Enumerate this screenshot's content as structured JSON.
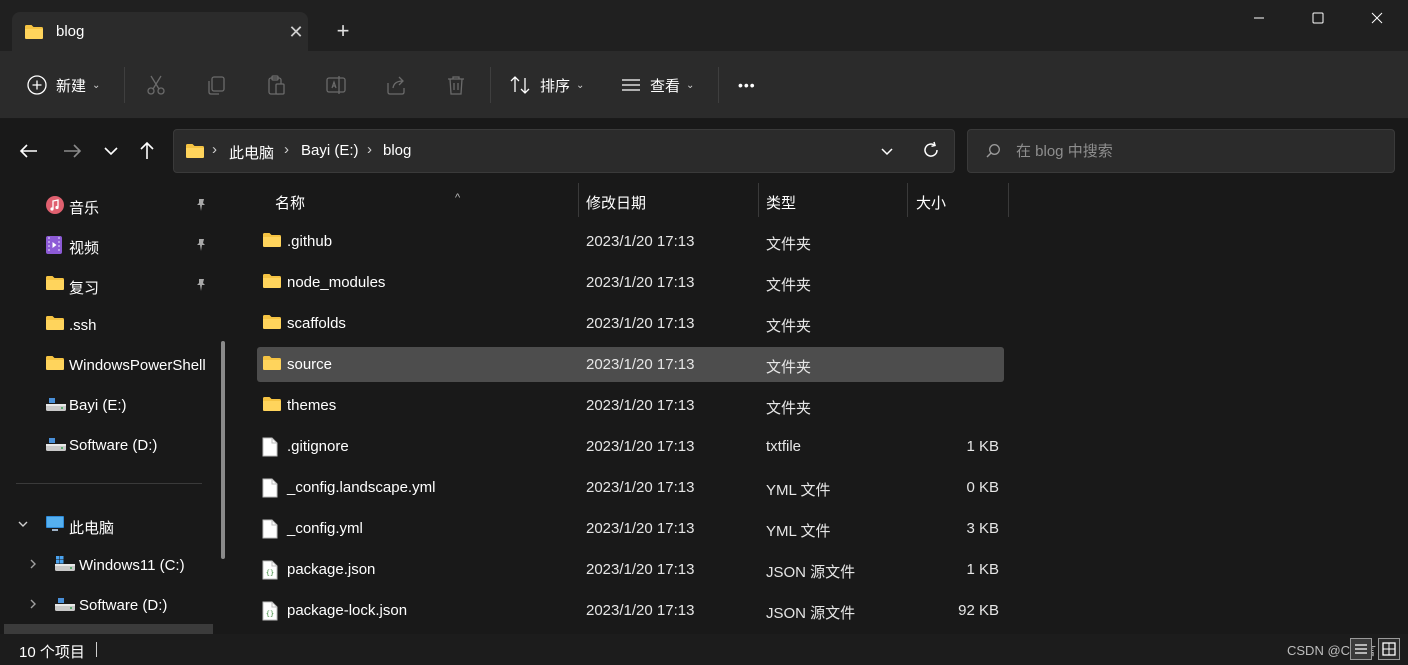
{
  "window": {
    "tab_title": "blog",
    "new_tab_label": "+",
    "close_tab_label": "✕"
  },
  "toolbar": {
    "new_label": "新建",
    "sort_label": "排序",
    "view_label": "查看",
    "more_label": "•••"
  },
  "address": {
    "breadcrumbs": [
      "此电脑",
      "Bayi (E:)",
      "blog"
    ],
    "separator": "›"
  },
  "search": {
    "placeholder": "在 blog 中搜索"
  },
  "sidebar": {
    "quick_access": [
      {
        "label": "音乐",
        "icon": "music-icon",
        "pinned": true
      },
      {
        "label": "视频",
        "icon": "video-icon",
        "pinned": true
      },
      {
        "label": "复习",
        "icon": "folder-icon",
        "pinned": true
      },
      {
        "label": ".ssh",
        "icon": "folder-icon",
        "pinned": false
      },
      {
        "label": "WindowsPowerShell",
        "icon": "folder-icon",
        "pinned": false
      },
      {
        "label": "Bayi (E:)",
        "icon": "drive-icon",
        "pinned": false
      },
      {
        "label": "Software (D:)",
        "icon": "drive-icon",
        "pinned": false
      }
    ],
    "this_pc": {
      "label": "此电脑",
      "children": [
        {
          "label": "Windows11 (C:)"
        },
        {
          "label": "Software (D:)"
        }
      ]
    }
  },
  "file_list": {
    "columns": [
      "名称",
      "修改日期",
      "类型",
      "大小"
    ],
    "rows": [
      {
        "name": ".github",
        "date": "2023/1/20 17:13",
        "type": "文件夹",
        "size": "",
        "kind": "folder"
      },
      {
        "name": "node_modules",
        "date": "2023/1/20 17:13",
        "type": "文件夹",
        "size": "",
        "kind": "folder"
      },
      {
        "name": "scaffolds",
        "date": "2023/1/20 17:13",
        "type": "文件夹",
        "size": "",
        "kind": "folder"
      },
      {
        "name": "source",
        "date": "2023/1/20 17:13",
        "type": "文件夹",
        "size": "",
        "kind": "folder",
        "selected": true
      },
      {
        "name": "themes",
        "date": "2023/1/20 17:13",
        "type": "文件夹",
        "size": "",
        "kind": "folder"
      },
      {
        "name": ".gitignore",
        "date": "2023/1/20 17:13",
        "type": "txtfile",
        "size": "1 KB",
        "kind": "file"
      },
      {
        "name": "_config.landscape.yml",
        "date": "2023/1/20 17:13",
        "type": "YML 文件",
        "size": "0 KB",
        "kind": "file"
      },
      {
        "name": "_config.yml",
        "date": "2023/1/20 17:13",
        "type": "YML 文件",
        "size": "3 KB",
        "kind": "file"
      },
      {
        "name": "package.json",
        "date": "2023/1/20 17:13",
        "type": "JSON 源文件",
        "size": "1 KB",
        "kind": "json"
      },
      {
        "name": "package-lock.json",
        "date": "2023/1/20 17:13",
        "type": "JSON 源文件",
        "size": "92 KB",
        "kind": "json"
      }
    ]
  },
  "status": {
    "item_count": "10 个项目",
    "watermark": "CSDN @C语言"
  },
  "colors": {
    "folder": "#f5c342",
    "selection": "#4d4d4d",
    "background": "#191919"
  }
}
